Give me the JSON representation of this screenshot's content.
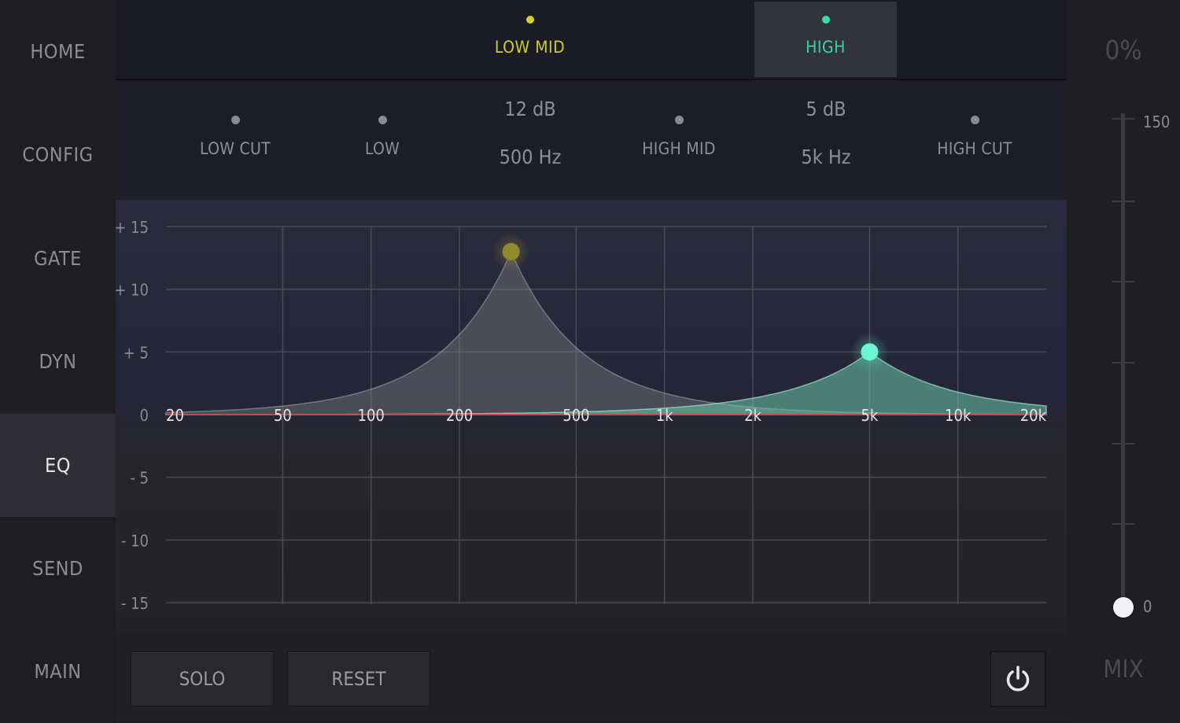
{
  "sidebar": {
    "items": [
      {
        "label": "HOME"
      },
      {
        "label": "CONFIG"
      },
      {
        "label": "GATE"
      },
      {
        "label": "DYN"
      },
      {
        "label": "EQ"
      },
      {
        "label": "SEND"
      },
      {
        "label": "MAIN"
      }
    ],
    "active": "EQ"
  },
  "bands": {
    "tabs": [
      {
        "label": "LOW MID",
        "color": "#d6d41e"
      },
      {
        "label": "HIGH",
        "color": "#2fe0a4"
      }
    ],
    "selected": "HIGH"
  },
  "band_params": [
    {
      "label": "LOW CUT"
    },
    {
      "label": "LOW"
    },
    {
      "gain": "12 dB",
      "freq": "500 Hz"
    },
    {
      "label": "HIGH MID"
    },
    {
      "gain": "5 dB",
      "freq": "5k Hz"
    },
    {
      "label": "HIGH CUT"
    }
  ],
  "graph": {
    "db_labels": [
      "+ 15",
      "+ 10",
      "+ 5",
      "0",
      "- 5",
      "- 10",
      "- 15"
    ],
    "freq_labels": [
      "20",
      "50",
      "100",
      "200",
      "500",
      "1k",
      "2k",
      "5k",
      "10k",
      "20k"
    ],
    "nodes": [
      {
        "band": "LOW MID",
        "freq_hz": 300,
        "gain_db": 13,
        "color": "#8f8a2a"
      },
      {
        "band": "HIGH",
        "freq_hz": 5000,
        "gain_db": 5,
        "color": "#6ff5d0"
      }
    ],
    "zero_line_color": "#c24a4a"
  },
  "footer": {
    "solo_label": "SOLO",
    "reset_label": "RESET",
    "power_icon": "power-icon"
  },
  "mix": {
    "percent": "0%",
    "label": "MIX",
    "max_label": "150",
    "min_label": "0",
    "value_percent": 0
  }
}
